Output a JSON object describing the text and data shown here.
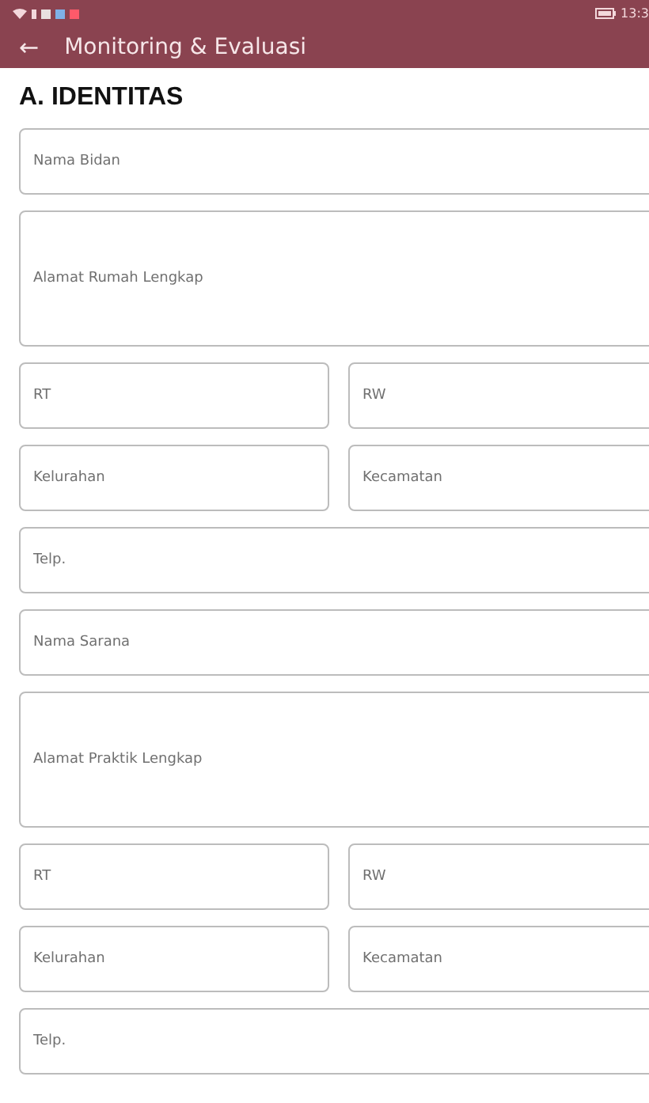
{
  "status_bar": {
    "time": "13:3"
  },
  "app_bar": {
    "title": "Monitoring & Evaluasi",
    "back": "←"
  },
  "section_title": "A. IDENTITAS",
  "rows": [
    {
      "kind": "single",
      "fields": [
        {
          "placeholder": "Nama Bidan"
        }
      ]
    },
    {
      "kind": "tall",
      "fields": [
        {
          "placeholder": "Alamat Rumah Lengkap"
        }
      ]
    },
    {
      "kind": "pair",
      "fields": [
        {
          "placeholder": "RT"
        },
        {
          "placeholder": "RW"
        }
      ]
    },
    {
      "kind": "pair",
      "fields": [
        {
          "placeholder": "Kelurahan"
        },
        {
          "placeholder": "Kecamatan"
        }
      ]
    },
    {
      "kind": "single",
      "fields": [
        {
          "placeholder": "Telp."
        }
      ]
    },
    {
      "kind": "single",
      "fields": [
        {
          "placeholder": "Nama Sarana"
        }
      ]
    },
    {
      "kind": "tall",
      "fields": [
        {
          "placeholder": "Alamat Praktik Lengkap"
        }
      ]
    },
    {
      "kind": "pair",
      "fields": [
        {
          "placeholder": "RT"
        },
        {
          "placeholder": "RW"
        }
      ]
    },
    {
      "kind": "pair",
      "fields": [
        {
          "placeholder": "Kelurahan"
        },
        {
          "placeholder": "Kecamatan"
        }
      ]
    },
    {
      "kind": "single",
      "fields": [
        {
          "placeholder": "Telp."
        }
      ]
    }
  ]
}
